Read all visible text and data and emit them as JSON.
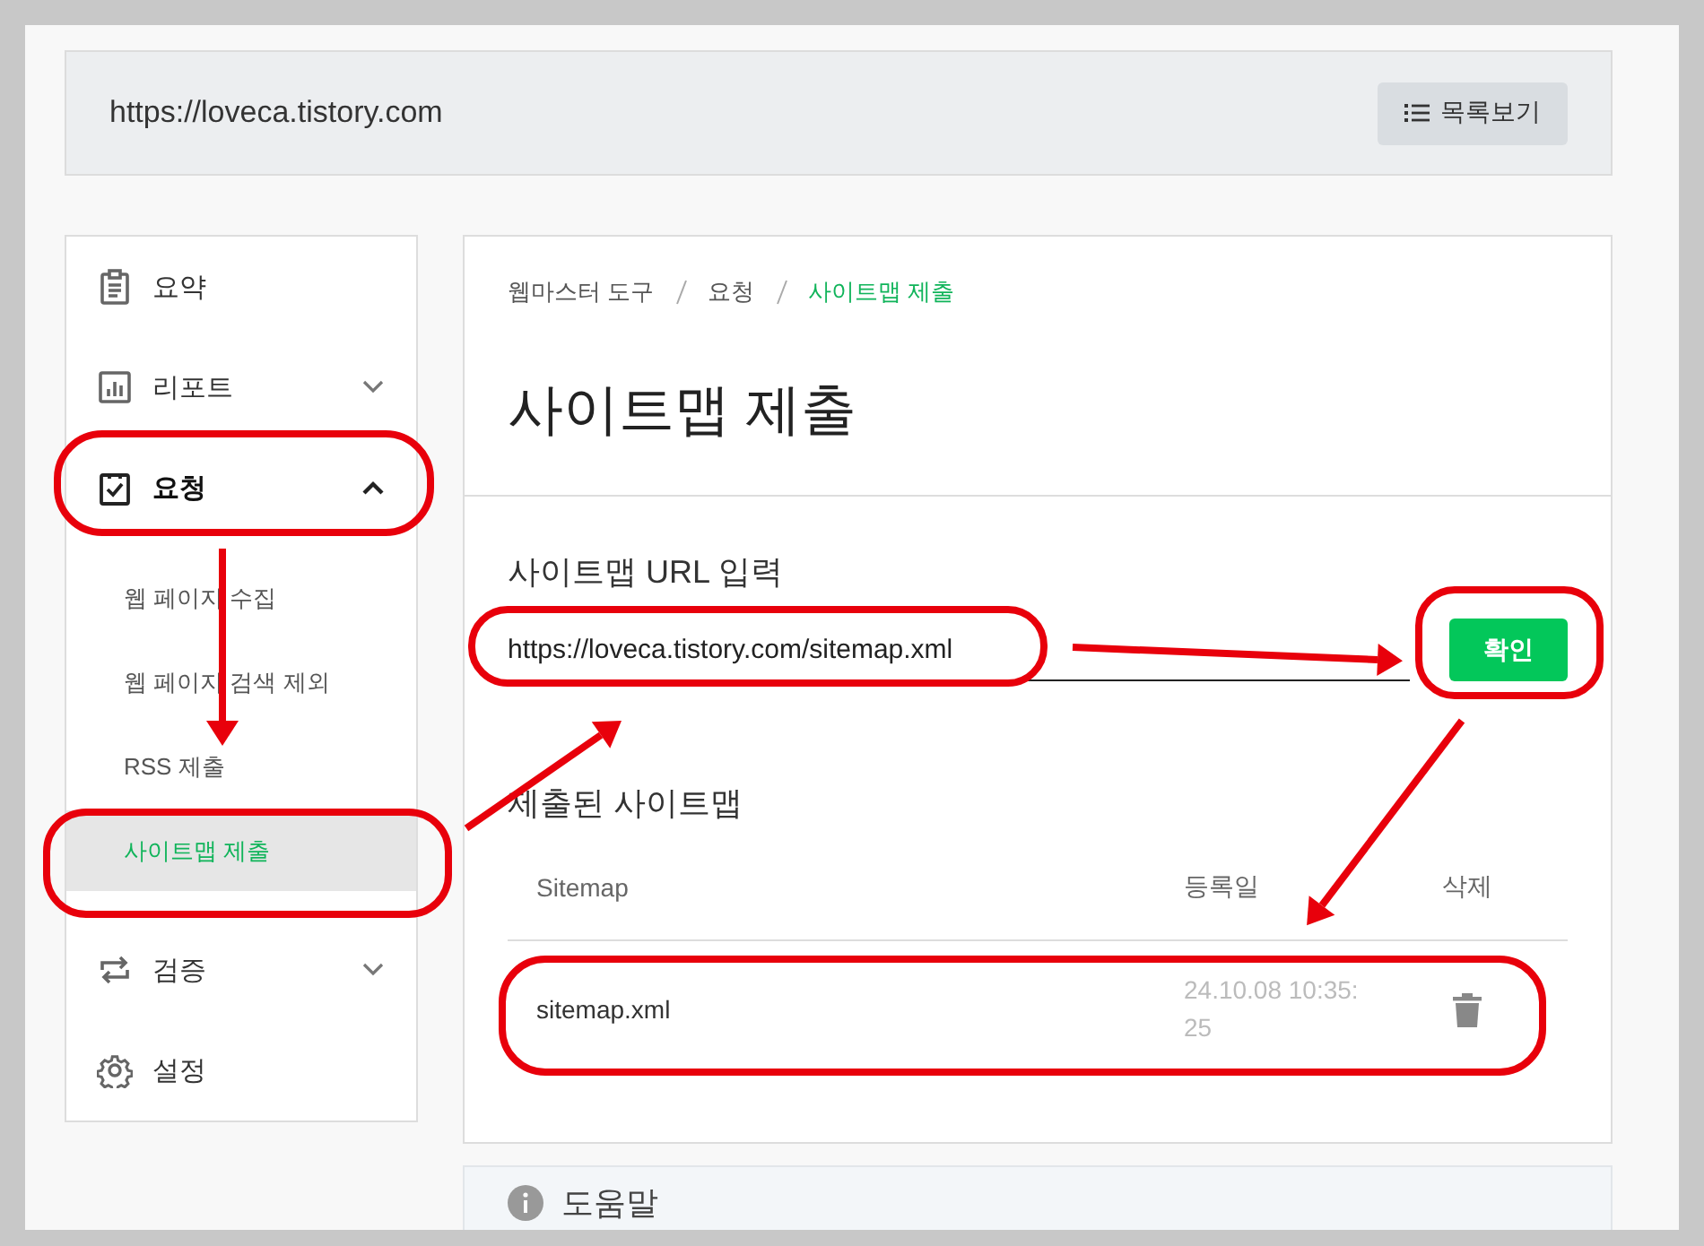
{
  "site_bar": {
    "url": "https://loveca.tistory.com",
    "list_button": "목록보기"
  },
  "sidebar": {
    "items": [
      {
        "label": "요약",
        "selected": false
      },
      {
        "label": "리포트",
        "selected": false,
        "expanded": false
      },
      {
        "label": "요청",
        "selected": true,
        "expanded": true,
        "children": [
          {
            "label": "웹 페이지 수집",
            "selected": false
          },
          {
            "label": "웹 페이지 검색 제외",
            "selected": false
          },
          {
            "label": "RSS 제출",
            "selected": false
          },
          {
            "label": "사이트맵 제출",
            "selected": true
          }
        ]
      },
      {
        "label": "검증",
        "selected": false,
        "expanded": false
      },
      {
        "label": "설정",
        "selected": false
      }
    ]
  },
  "main": {
    "breadcrumb": [
      {
        "label": "웹마스터 도구",
        "selected": false
      },
      {
        "label": "요청",
        "selected": false
      },
      {
        "label": "사이트맵 제출",
        "selected": true
      }
    ],
    "title": "사이트맵 제출",
    "url_form": {
      "label": "사이트맵 URL 입력",
      "value": "https://loveca.tistory.com/sitemap.xml",
      "button": "확인"
    },
    "submitted": {
      "title": "제출된 사이트맵",
      "columns": [
        "Sitemap",
        "등록일",
        "삭제"
      ],
      "rows": [
        {
          "sitemap": "sitemap.xml",
          "registered": "24.10.08 10:35:25"
        }
      ]
    }
  },
  "help": {
    "title": "도움말"
  }
}
